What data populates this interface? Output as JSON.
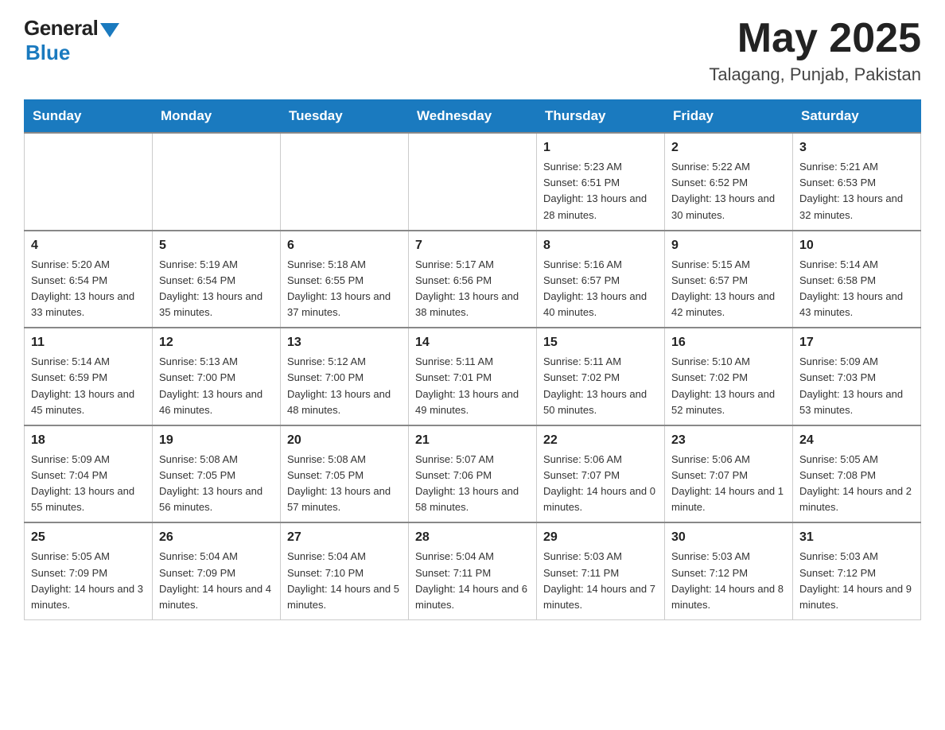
{
  "header": {
    "logo_general": "General",
    "logo_blue": "Blue",
    "month_year": "May 2025",
    "location": "Talagang, Punjab, Pakistan"
  },
  "weekdays": [
    "Sunday",
    "Monday",
    "Tuesday",
    "Wednesday",
    "Thursday",
    "Friday",
    "Saturday"
  ],
  "weeks": [
    [
      {
        "day": "",
        "info": ""
      },
      {
        "day": "",
        "info": ""
      },
      {
        "day": "",
        "info": ""
      },
      {
        "day": "",
        "info": ""
      },
      {
        "day": "1",
        "info": "Sunrise: 5:23 AM\nSunset: 6:51 PM\nDaylight: 13 hours and 28 minutes."
      },
      {
        "day": "2",
        "info": "Sunrise: 5:22 AM\nSunset: 6:52 PM\nDaylight: 13 hours and 30 minutes."
      },
      {
        "day": "3",
        "info": "Sunrise: 5:21 AM\nSunset: 6:53 PM\nDaylight: 13 hours and 32 minutes."
      }
    ],
    [
      {
        "day": "4",
        "info": "Sunrise: 5:20 AM\nSunset: 6:54 PM\nDaylight: 13 hours and 33 minutes."
      },
      {
        "day": "5",
        "info": "Sunrise: 5:19 AM\nSunset: 6:54 PM\nDaylight: 13 hours and 35 minutes."
      },
      {
        "day": "6",
        "info": "Sunrise: 5:18 AM\nSunset: 6:55 PM\nDaylight: 13 hours and 37 minutes."
      },
      {
        "day": "7",
        "info": "Sunrise: 5:17 AM\nSunset: 6:56 PM\nDaylight: 13 hours and 38 minutes."
      },
      {
        "day": "8",
        "info": "Sunrise: 5:16 AM\nSunset: 6:57 PM\nDaylight: 13 hours and 40 minutes."
      },
      {
        "day": "9",
        "info": "Sunrise: 5:15 AM\nSunset: 6:57 PM\nDaylight: 13 hours and 42 minutes."
      },
      {
        "day": "10",
        "info": "Sunrise: 5:14 AM\nSunset: 6:58 PM\nDaylight: 13 hours and 43 minutes."
      }
    ],
    [
      {
        "day": "11",
        "info": "Sunrise: 5:14 AM\nSunset: 6:59 PM\nDaylight: 13 hours and 45 minutes."
      },
      {
        "day": "12",
        "info": "Sunrise: 5:13 AM\nSunset: 7:00 PM\nDaylight: 13 hours and 46 minutes."
      },
      {
        "day": "13",
        "info": "Sunrise: 5:12 AM\nSunset: 7:00 PM\nDaylight: 13 hours and 48 minutes."
      },
      {
        "day": "14",
        "info": "Sunrise: 5:11 AM\nSunset: 7:01 PM\nDaylight: 13 hours and 49 minutes."
      },
      {
        "day": "15",
        "info": "Sunrise: 5:11 AM\nSunset: 7:02 PM\nDaylight: 13 hours and 50 minutes."
      },
      {
        "day": "16",
        "info": "Sunrise: 5:10 AM\nSunset: 7:02 PM\nDaylight: 13 hours and 52 minutes."
      },
      {
        "day": "17",
        "info": "Sunrise: 5:09 AM\nSunset: 7:03 PM\nDaylight: 13 hours and 53 minutes."
      }
    ],
    [
      {
        "day": "18",
        "info": "Sunrise: 5:09 AM\nSunset: 7:04 PM\nDaylight: 13 hours and 55 minutes."
      },
      {
        "day": "19",
        "info": "Sunrise: 5:08 AM\nSunset: 7:05 PM\nDaylight: 13 hours and 56 minutes."
      },
      {
        "day": "20",
        "info": "Sunrise: 5:08 AM\nSunset: 7:05 PM\nDaylight: 13 hours and 57 minutes."
      },
      {
        "day": "21",
        "info": "Sunrise: 5:07 AM\nSunset: 7:06 PM\nDaylight: 13 hours and 58 minutes."
      },
      {
        "day": "22",
        "info": "Sunrise: 5:06 AM\nSunset: 7:07 PM\nDaylight: 14 hours and 0 minutes."
      },
      {
        "day": "23",
        "info": "Sunrise: 5:06 AM\nSunset: 7:07 PM\nDaylight: 14 hours and 1 minute."
      },
      {
        "day": "24",
        "info": "Sunrise: 5:05 AM\nSunset: 7:08 PM\nDaylight: 14 hours and 2 minutes."
      }
    ],
    [
      {
        "day": "25",
        "info": "Sunrise: 5:05 AM\nSunset: 7:09 PM\nDaylight: 14 hours and 3 minutes."
      },
      {
        "day": "26",
        "info": "Sunrise: 5:04 AM\nSunset: 7:09 PM\nDaylight: 14 hours and 4 minutes."
      },
      {
        "day": "27",
        "info": "Sunrise: 5:04 AM\nSunset: 7:10 PM\nDaylight: 14 hours and 5 minutes."
      },
      {
        "day": "28",
        "info": "Sunrise: 5:04 AM\nSunset: 7:11 PM\nDaylight: 14 hours and 6 minutes."
      },
      {
        "day": "29",
        "info": "Sunrise: 5:03 AM\nSunset: 7:11 PM\nDaylight: 14 hours and 7 minutes."
      },
      {
        "day": "30",
        "info": "Sunrise: 5:03 AM\nSunset: 7:12 PM\nDaylight: 14 hours and 8 minutes."
      },
      {
        "day": "31",
        "info": "Sunrise: 5:03 AM\nSunset: 7:12 PM\nDaylight: 14 hours and 9 minutes."
      }
    ]
  ]
}
